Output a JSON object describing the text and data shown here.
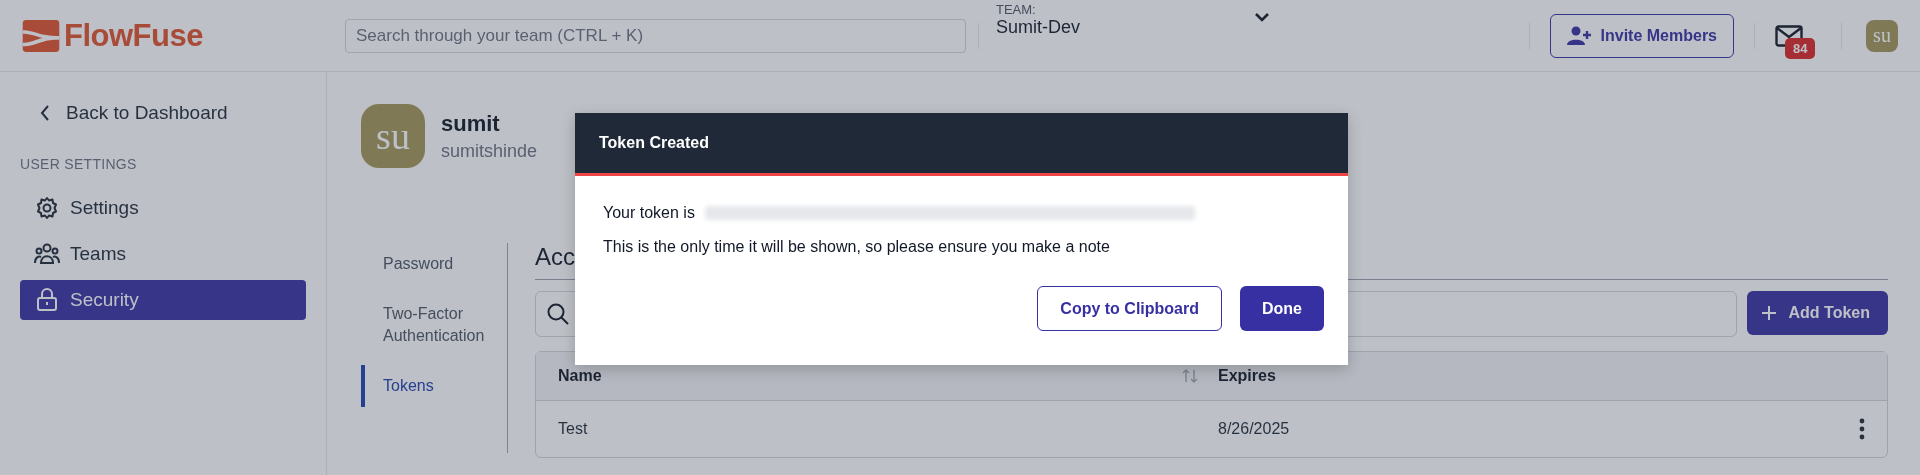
{
  "header": {
    "logo": "FlowFuse",
    "search": {
      "placeholder": "Search through your team (CTRL + K)"
    },
    "team_label": "TEAM:",
    "team_name": "Sumit-Dev",
    "invite_button": "Invite Members",
    "notification_count": "84",
    "avatar": "su"
  },
  "sidebar": {
    "back_link": "Back to Dashboard",
    "section_title": "USER SETTINGS",
    "items": [
      {
        "label": "Settings",
        "selected": false
      },
      {
        "label": "Teams",
        "selected": false
      },
      {
        "label": "Security",
        "selected": true
      }
    ]
  },
  "profile": {
    "avatar": "su",
    "name": "sumit",
    "username": "sumitshinde"
  },
  "subnav": [
    {
      "label": "Password",
      "selected": false
    },
    {
      "label": "Two-Factor Authentication",
      "selected": false
    },
    {
      "label": "Tokens",
      "selected": true
    }
  ],
  "section_heading": "Acc",
  "add_button": "Add Token",
  "table": {
    "columns": [
      {
        "label": "Name",
        "sortable": true
      },
      {
        "label": "Expires",
        "sortable": false
      }
    ],
    "rows": [
      {
        "cells": [
          "Test",
          "8/26/2025"
        ]
      }
    ]
  },
  "modal": {
    "title": "Token Created",
    "token_label": "Your token is",
    "note": "This is the only time it will be shown, so please ensure you make a note",
    "buttons": [
      {
        "label": "Copy to Clipboard",
        "kind": "secondary"
      },
      {
        "label": "Done",
        "kind": "primary"
      }
    ]
  }
}
